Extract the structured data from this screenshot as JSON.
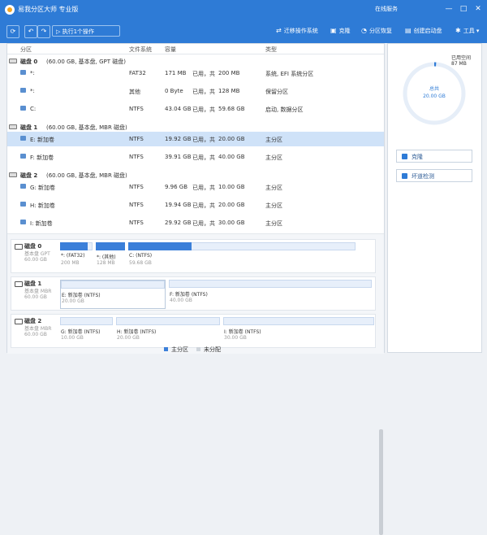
{
  "app": {
    "title": "易我分区大师 专业版",
    "service_label": "在线服务"
  },
  "window": {
    "minimize": "—",
    "maximize": "□",
    "close": "✕"
  },
  "toolbar": {
    "refresh": "⟳",
    "undo": "↶",
    "redo": "↷",
    "execute_label": "▷ 执行1个操作",
    "tools": [
      {
        "icon": "⇄",
        "label": "迁移操作系统"
      },
      {
        "icon": "▣",
        "label": "克隆"
      },
      {
        "icon": "◔",
        "label": "分区恢复"
      },
      {
        "icon": "▤",
        "label": "创建启动盘"
      },
      {
        "icon": "✱",
        "label": "工具 ▾"
      }
    ]
  },
  "table": {
    "headers": {
      "partition": "分区",
      "fs": "文件系统",
      "capacity": "容量",
      "type": "类型"
    },
    "rows": [
      {
        "kind": "disk",
        "name": "磁盘 0",
        "info": "(60.00 GB, 基本盘, GPT 磁盘)"
      },
      {
        "kind": "part",
        "name": "*:",
        "fs": "FAT32",
        "used": "171 MB",
        "free": "已用，共",
        "total": "200 MB",
        "type": "系统, EFI 系统分区"
      },
      {
        "kind": "part",
        "name": "*:",
        "fs": "其他",
        "used": "0 Byte",
        "free": "已用，共",
        "total": "128 MB",
        "type": "保留分区"
      },
      {
        "kind": "part",
        "name": "C:",
        "fs": "NTFS",
        "used": "43.04 GB",
        "free": "已用，共",
        "total": "59.68 GB",
        "type": "启动, 数据分区"
      },
      {
        "kind": "disk",
        "name": "磁盘 1",
        "info": "(60.00 GB, 基本盘, MBR 磁盘)"
      },
      {
        "kind": "part",
        "name": "E: 新加卷",
        "fs": "NTFS",
        "used": "19.92 GB",
        "free": "已用，共",
        "total": "20.00 GB",
        "type": "主分区",
        "selected": true
      },
      {
        "kind": "part",
        "name": "F: 新加卷",
        "fs": "NTFS",
        "used": "39.91 GB",
        "free": "已用，共",
        "total": "40.00 GB",
        "type": "主分区"
      },
      {
        "kind": "disk",
        "name": "磁盘 2",
        "info": "(60.00 GB, 基本盘, MBR 磁盘)"
      },
      {
        "kind": "part",
        "name": "G: 新加卷",
        "fs": "NTFS",
        "used": "9.96 GB",
        "free": "已用，共",
        "total": "10.00 GB",
        "type": "主分区"
      },
      {
        "kind": "part",
        "name": "H: 新加卷",
        "fs": "NTFS",
        "used": "19.94 GB",
        "free": "已用，共",
        "total": "20.00 GB",
        "type": "主分区"
      },
      {
        "kind": "part",
        "name": "I: 新加卷",
        "fs": "NTFS",
        "used": "29.92 GB",
        "free": "已用，共",
        "total": "30.00 GB",
        "type": "主分区"
      }
    ]
  },
  "disk_map": [
    {
      "name": "磁盘 0",
      "type": "基本盘 GPT",
      "size": "60.00 GB",
      "segments": [
        {
          "label": "*: (FAT32)",
          "size": "200 MB",
          "fill": 0.85
        },
        {
          "label": "*: (其他)",
          "size": "128 MB",
          "fill": 1.0
        },
        {
          "label": "C: (NTFS)",
          "size": "59.68 GB",
          "fill": 0.28
        }
      ]
    },
    {
      "name": "磁盘 1",
      "type": "基本盘 MBR",
      "size": "60.00 GB",
      "segments": [
        {
          "label": "E: 新加卷 (NTFS)",
          "size": "20.00 GB",
          "fill": 0.0
        },
        {
          "label": "F: 新加卷 (NTFS)",
          "size": "40.00 GB",
          "fill": 0.0
        }
      ]
    },
    {
      "name": "磁盘 2",
      "type": "基本盘 MBR",
      "size": "60.00 GB",
      "segments": [
        {
          "label": "G: 新加卷 (NTFS)",
          "size": "10.00 GB",
          "fill": 0.0
        },
        {
          "label": "H: 新加卷 (NTFS)",
          "size": "20.00 GB",
          "fill": 0.0
        },
        {
          "label": "I: 新加卷 (NTFS)",
          "size": "30.00 GB",
          "fill": 0.0
        }
      ]
    }
  ],
  "legend": {
    "primary": "主分区",
    "unallocated": "未分配",
    "primary_color": "#3b7fd9",
    "unalloc_color": "#cfd5dc"
  },
  "side": {
    "used_label": "已用空间",
    "used_value": "87 MB",
    "total_label": "总共",
    "total_value": "20.00 GB",
    "used_fraction": 0.004,
    "buttons": [
      {
        "label": "克隆"
      },
      {
        "label": "坏道检测"
      }
    ]
  },
  "colors": {
    "accent": "#2e7bd6",
    "selected_row": "#cfe2f8"
  }
}
